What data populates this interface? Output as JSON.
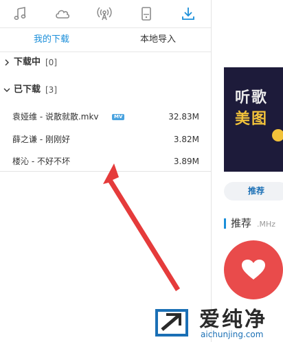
{
  "toolbar": {
    "icons": [
      "music-note-icon",
      "cloud-icon",
      "radio-icon",
      "device-icon",
      "download-icon"
    ],
    "active": "download-icon",
    "accent_color": "#1a8ed9"
  },
  "tabs": {
    "mine": "我的下载",
    "import": "本地导入"
  },
  "downloading": {
    "label": "下载中",
    "count": "[0]",
    "expanded": false
  },
  "downloaded": {
    "label": "已下载",
    "count": "[3]",
    "expanded": true,
    "items": [
      {
        "name": "袁娅维 - 说散就散.mkv",
        "badge": "MV",
        "size": "32.83M"
      },
      {
        "name": "薛之谦 - 刚刚好",
        "size": "3.82M"
      },
      {
        "name": "楼沁 - 不好不坏",
        "size": "3.89M"
      }
    ]
  },
  "right_panel": {
    "banner_line1": "听歌",
    "banner_line2": "美图",
    "rec_button": "推荐",
    "rec_heading": "推荐",
    "rec_sub": ".MHz"
  },
  "watermark": {
    "text": "爱纯净",
    "url": "aichunjing.com"
  },
  "annotation": {
    "arrow_color": "#e53b3b"
  }
}
